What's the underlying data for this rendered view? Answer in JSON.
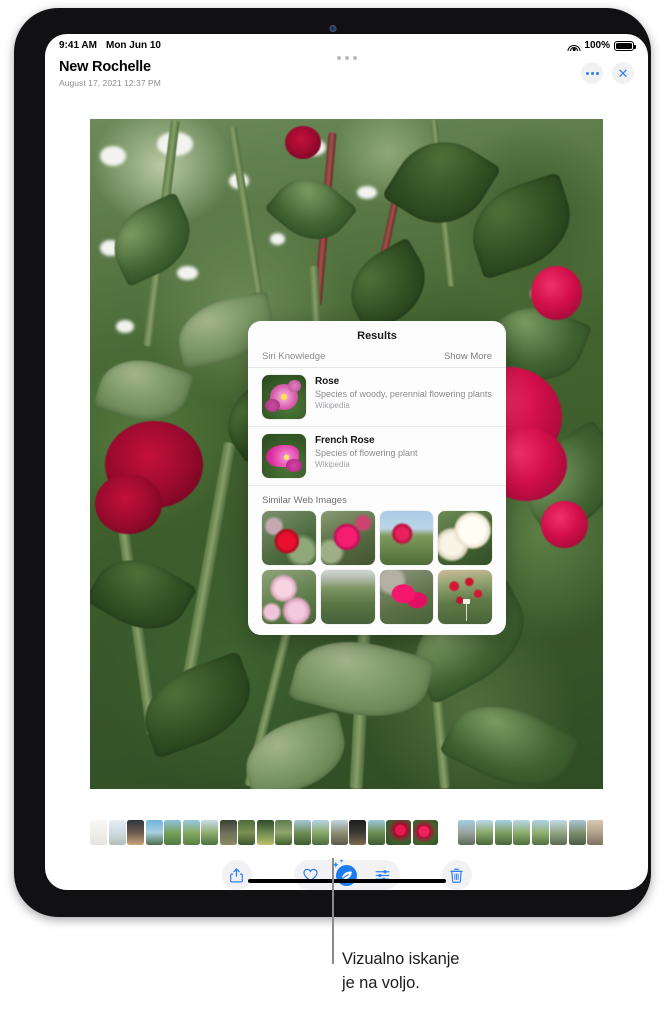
{
  "status_bar": {
    "time": "9:41 AM",
    "date": "Mon Jun 10",
    "wifi_icon": "wifi-icon",
    "battery_percent": "100%",
    "battery_icon": "battery-full-icon"
  },
  "header": {
    "title": "New Rochelle",
    "subtitle": "August 17, 2021  12:37 PM",
    "more_button": "more-options-icon",
    "close_button": "✕"
  },
  "results_panel": {
    "title": "Results",
    "section": {
      "label": "Siri Knowledge",
      "action": "Show More"
    },
    "knowledge_items": [
      {
        "name": "Rose",
        "description": "Species of woody, perennial flowering plants",
        "source": "Wikipedia",
        "thumbnail": "pink-rose-thumbnail"
      },
      {
        "name": "French Rose",
        "description": "Species of flowering plant",
        "source": "Wikipedia",
        "thumbnail": "magenta-rose-thumbnail"
      }
    ],
    "similar_label": "Similar Web Images",
    "similar_images": [
      {
        "name": "red-rose-bush"
      },
      {
        "name": "pink-rose-cluster"
      },
      {
        "name": "rose-garden-sky"
      },
      {
        "name": "white-roses"
      },
      {
        "name": "pale-pink-roses"
      },
      {
        "name": "rose-hedge-foliage"
      },
      {
        "name": "magenta-rose-buds"
      },
      {
        "name": "red-rose-shrub-sign"
      }
    ]
  },
  "toolbar": {
    "share_label": "share-icon",
    "favorite_label": "heart-icon",
    "visual_lookup_label": "visual-look-up-icon",
    "adjust_label": "adjust-sliders-icon",
    "delete_label": "trash-icon"
  },
  "callout": {
    "text": "Vizualno iskanje\nje na voljo."
  },
  "colors": {
    "accent": "#2f7ff6",
    "vlu_active": "#1d7cf2",
    "panel_bg": "#fdfdfd",
    "chip_bg": "#f2f2f4",
    "muted_text": "#8a8a8f"
  },
  "photo": {
    "name": "rose-bush-photo",
    "filmstrip_count": 34,
    "selected_index": 16
  }
}
